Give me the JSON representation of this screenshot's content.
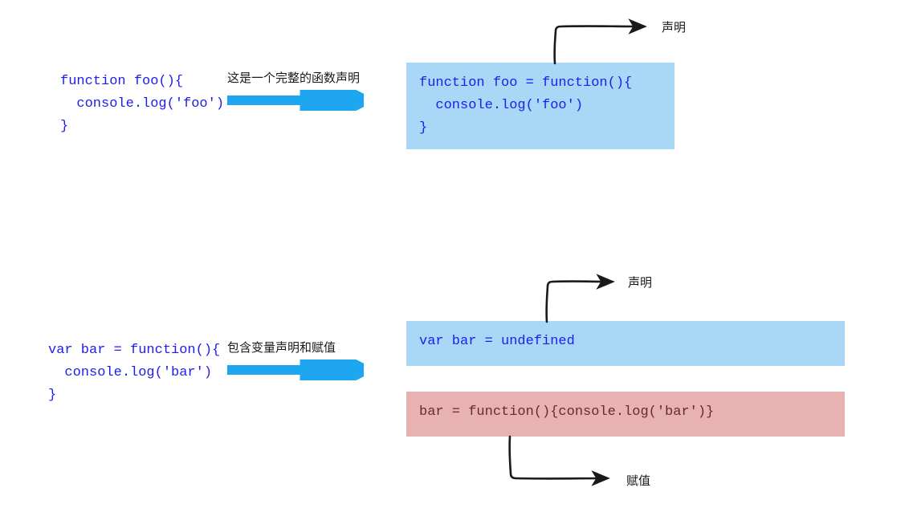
{
  "section1": {
    "left_code": "function foo(){\n  console.log('foo')\n}",
    "arrow_label": "这是一个完整的函数声明",
    "right_code": "function foo = function(){\n  console.log('foo')\n}",
    "annotation": "声明"
  },
  "section2": {
    "left_code": "var bar = function(){\n  console.log('bar')\n}",
    "arrow_label": "包含变量声明和赋值",
    "right_code_top": "var bar = undefined",
    "right_code_bottom": "bar = function(){console.log('bar')}",
    "annotation_top": "声明",
    "annotation_bottom": "赋值"
  },
  "colors": {
    "code": "#1d1ded",
    "arrow_blue": "#1ea7f0",
    "box_blue": "#a8d8f5",
    "box_red": "#e8b2b2",
    "text_red": "#6b2a2a",
    "sketchy": "#1a1a1a"
  }
}
